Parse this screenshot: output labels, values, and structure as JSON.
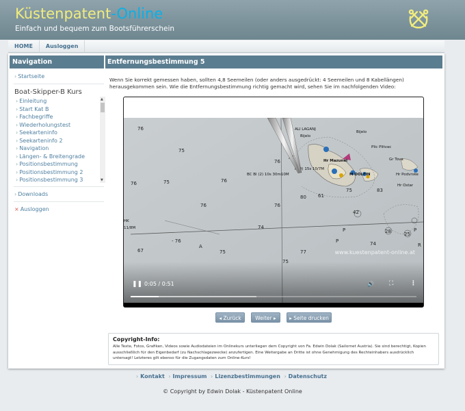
{
  "header": {
    "title_part1": "Küstenpatent",
    "title_part2": "-Online",
    "subtitle": "Einfach und bequem zum Bootsführerschein",
    "title_color1": "#f1ec7d",
    "title_color2": "#0ab0e6"
  },
  "topnav": {
    "items": [
      {
        "label": "HOME"
      },
      {
        "label": "Ausloggen"
      }
    ]
  },
  "sidebar": {
    "heading": "Navigation",
    "home_link": "Startseite",
    "course_title": "Boat-Skipper-B Kurs",
    "course_items": [
      "Einleitung",
      "Start Kat B",
      "Fachbegriffe",
      "Wiederholungstest",
      "Seekarteninfo",
      "Seekarteninfo 2",
      "Navigation",
      "Längen- & Breitengrade",
      "Positionsbestimmung",
      "Positionsbestimmung 2",
      "Positionsbestimmung 3"
    ],
    "downloads_link": "Downloads",
    "logout_link": "Ausloggen"
  },
  "content": {
    "heading": "Entfernungsbestimmung 5",
    "intro": "Wenn Sie korrekt gemessen haben, sollten 4,8 Seemeilen (oder anders ausgedrückt: 4 Seemeilen und 8 Kabellängen) herausgekommen sein. Wie die Entfernungsbestimmung richtig gemacht wird, sehen Sie im nachfolgenden Video:"
  },
  "video": {
    "time": "0:05 / 0:51",
    "progress_fraction": 0.098,
    "buffered_fraction": 0.44,
    "watermark": "www.kuestenpatent-online.at",
    "map_labels": [
      "76",
      "75",
      "76",
      "75",
      "76",
      "74",
      "77",
      "74",
      "75",
      "76",
      "67",
      "75",
      "80",
      "61",
      "75",
      "83",
      "74",
      "42",
      "28",
      "25",
      "74",
      "P",
      "P",
      "P",
      "P",
      "P",
      "R",
      "A",
      "Hr Mazunel",
      "Hr Podvrske",
      "Gr Tova",
      "M DOLFIN",
      "Bijelo",
      "Plitvac",
      "Plic Plitvac",
      "Hr Ostar",
      "ALI LAGANJ",
      "BC Bl (2) 10s 30m10M",
      "FI(4) 15s 10/7M",
      "HK",
      "11/8M",
      "- 76"
    ]
  },
  "buttons": {
    "back": "◂ Zurück",
    "next": "Weiter ▸",
    "print": "▸ Seite drucken"
  },
  "copyright_box": {
    "title": "Copyright-Info:",
    "text": "Alle Texte, Fotos, Grafiken, Videos sowie Audiodateien im Onlinekurs unterliegen dem Copyright von Fa. Edwin Dolak (Sailornet Austria). Sie sind berechtigt, Kopien ausschließlich für den Eigenbedarf (zu Nachschlagezwecke) anzufertigen. Eine Weitergabe an Dritte ist ohne Genehmigung des Rechteinhabers ausdrücklich untersagt! Letzteres gilt ebenso für die Zugangsdaten zum Online-Kurs!"
  },
  "footer": {
    "links": [
      "Kontakt",
      "Impressum",
      "Lizenzbestimmungen",
      "Datenschutz"
    ],
    "copyright": "© Copyright by Edwin Dolak - Küstenpatent Online"
  },
  "icons": {
    "anchor": "anchor-icon",
    "play_pause": "pause-icon",
    "volume": "volume-icon",
    "fullscreen": "fullscreen-icon",
    "more": "more-icon"
  }
}
